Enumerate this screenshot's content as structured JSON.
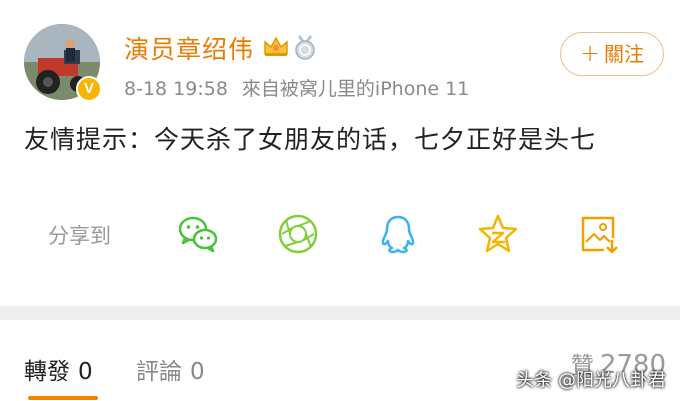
{
  "post": {
    "username": "演员章绍伟",
    "timestamp": "8-18 19:58",
    "source": "來自被窝儿里的iPhone 11",
    "content": "友情提示：今天杀了女朋友的话，七夕正好是头七",
    "verified_badge": "V",
    "badges": [
      "crown-icon",
      "medal-icon"
    ]
  },
  "follow": {
    "plus": "+",
    "label": "關注"
  },
  "share": {
    "label": "分享到",
    "targets": [
      "wechat-icon",
      "moments-icon",
      "qq-icon",
      "qzone-icon",
      "save-image-icon"
    ],
    "colors": {
      "wechat": "#48c23b",
      "moments": "#7fcf3a",
      "qq": "#3ab3ee",
      "qzone": "#f5b400",
      "save": "#f0a000"
    }
  },
  "tabs": {
    "repost_label": "轉發",
    "repost_count": "0",
    "comment_label": "評論",
    "comment_count": "0",
    "likes_label": "贊",
    "likes_count": "2780"
  },
  "watermark": "头条 @阳光八卦君",
  "colors": {
    "accent": "#e87b00",
    "accent_border": "#f2b98a",
    "tab_active": "#f08300",
    "verified": "#f7b500",
    "divider": "#efefef"
  }
}
